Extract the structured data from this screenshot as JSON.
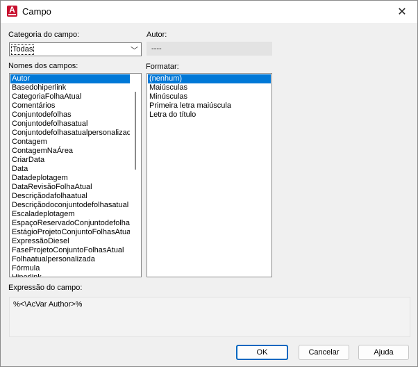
{
  "window": {
    "title": "Campo",
    "close_glyph": "✕"
  },
  "category": {
    "label": "Categoria do campo:",
    "selected": "Todas"
  },
  "author": {
    "label": "Autor:",
    "value": "----"
  },
  "field_names": {
    "label": "Nomes dos campos:",
    "items": [
      "Autor",
      "Basedohiperlink",
      "CategoriaFolhaAtual",
      "Comentários",
      "Conjuntodefolhas",
      "Conjuntodefolhasatual",
      "Conjuntodefolhasatualpersonalizad",
      "Contagem",
      "ContagemNaÁrea",
      "CriarData",
      "Data",
      "Datadeplotagem",
      "DataRevisãoFolhaAtual",
      "Descriçãodafolhaatual",
      "Descriçãodoconjuntodefolhasatual",
      "Escaladeplotagem",
      "EspaçoReservadoConjuntodefolhas",
      "EstágioProjetoConjuntoFolhasAtual",
      "ExpressãoDiesel",
      "FaseProjetoConjuntoFolhasAtual",
      "Folhaatualpersonalizada",
      "Fórmula",
      "Hiperlink"
    ],
    "selected_index": 0
  },
  "format": {
    "label": "Formatar:",
    "items": [
      "(nenhum)",
      "Maiúsculas",
      "Minúsculas",
      "Primeira letra maiúscula",
      "Letra do título"
    ],
    "selected_index": 0
  },
  "expression": {
    "label": "Expressão do campo:",
    "value": "%<\\AcVar Author>%"
  },
  "buttons": {
    "ok": "OK",
    "cancel": "Cancelar",
    "help": "Ajuda"
  },
  "colors": {
    "accent": "#0078d7",
    "app_icon": "#c8102e"
  }
}
